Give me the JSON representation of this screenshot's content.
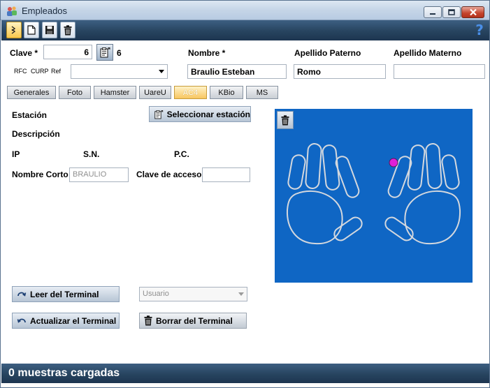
{
  "window": {
    "title": "Empleados",
    "icon": "users-app-icon"
  },
  "toolbar": {
    "buttons": [
      {
        "name": "expand",
        "icon": "double-chevron-icon"
      },
      {
        "name": "new",
        "icon": "new-document-icon"
      },
      {
        "name": "save",
        "icon": "floppy-disk-icon"
      },
      {
        "name": "delete",
        "icon": "trash-icon"
      }
    ],
    "help_label": "?"
  },
  "form": {
    "clave_label": "Clave *",
    "clave_value": "6",
    "clave_count": "6",
    "nombre_label": "Nombre *",
    "nombre_value": "Braulio Esteban",
    "apellido_paterno_label": "Apellido Paterno",
    "apellido_paterno_value": "Romo",
    "apellido_materno_label": "Apellido Materno",
    "apellido_materno_value": "",
    "rfc_label": "RFC",
    "curp_label": "CURP",
    "ref_label": "Ref",
    "rfc_select_value": ""
  },
  "tabs": [
    {
      "label": "Generales",
      "active": false
    },
    {
      "label": "Foto",
      "active": false
    },
    {
      "label": "Hamster",
      "active": false
    },
    {
      "label": "UareU",
      "active": false
    },
    {
      "label": "AC4",
      "active": true
    },
    {
      "label": "KBio",
      "active": false
    },
    {
      "label": "MS",
      "active": false
    }
  ],
  "ac4": {
    "estacion_label": "Estación",
    "seleccionar_label": "Seleccionar estación",
    "descripcion_label": "Descripción",
    "ip_label": "IP",
    "sn_label": "S.N.",
    "pc_label": "P.C.",
    "nombre_corto_label": "Nombre Corto",
    "nombre_corto_value": "BRAULIO",
    "clave_acceso_label": "Clave de acceso",
    "clave_acceso_value": "",
    "leer_label": "Leer del Terminal",
    "usuario_select": "Usuario",
    "actualizar_label": "Actualizar el Terminal",
    "borrar_label": "Borrar del Terminal",
    "selected_finger": "right-index"
  },
  "status": {
    "text": "0 muestras cargadas"
  },
  "colors": {
    "panel_bg": "#0f66c4",
    "hand_outline": "#d4d8de",
    "finger_marker": "#e01fd8",
    "bar_dark": "#27445f",
    "active_tab": "#f8c660"
  }
}
